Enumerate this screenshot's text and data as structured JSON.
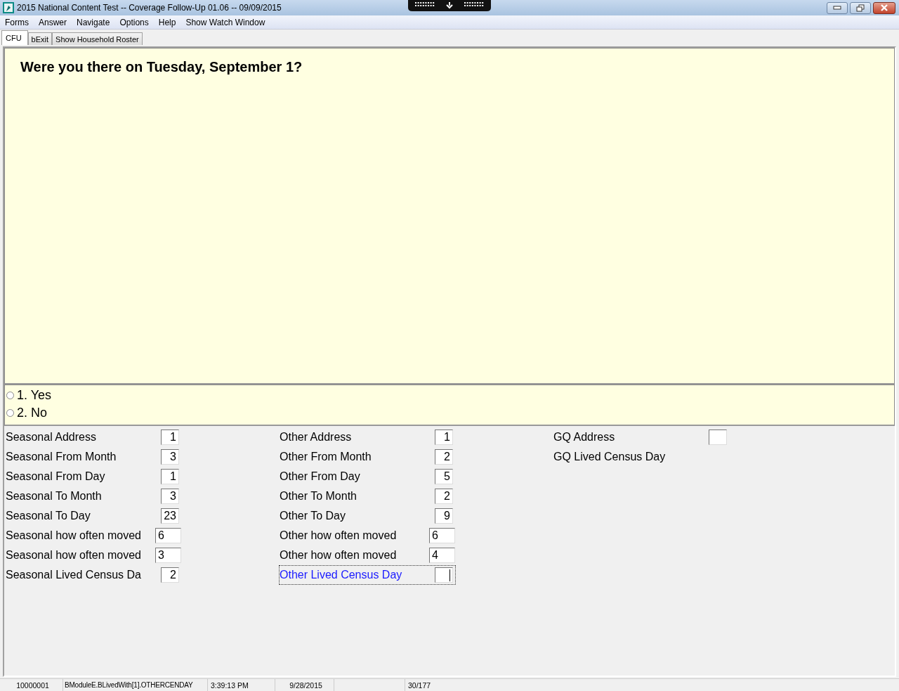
{
  "window": {
    "title": "2015 National Content Test -- Coverage Follow-Up 01.06 -- 09/09/2015"
  },
  "menu": [
    "Forms",
    "Answer",
    "Navigate",
    "Options",
    "Help",
    "Show Watch Window"
  ],
  "tabs": [
    {
      "label": "CFU",
      "selected": true
    },
    {
      "label": "bExit",
      "selected": false
    },
    {
      "label": "Show Household Roster",
      "selected": false
    }
  ],
  "question": "Were you there on Tuesday, September 1?",
  "answers": [
    {
      "label": "1. Yes",
      "selected": false
    },
    {
      "label": "2. No",
      "selected": false
    }
  ],
  "field_columns": [
    [
      {
        "label": "Seasonal Address",
        "value": "1",
        "kind": "narrow",
        "focused": false
      },
      {
        "label": "Seasonal From Month",
        "value": "3",
        "kind": "narrow",
        "focused": false
      },
      {
        "label": "Seasonal From Day",
        "value": "1",
        "kind": "narrow",
        "focused": false
      },
      {
        "label": "Seasonal To Month",
        "value": "3",
        "kind": "narrow",
        "focused": false
      },
      {
        "label": "Seasonal To Day",
        "value": "23",
        "kind": "narrow",
        "focused": false
      },
      {
        "label": "Seasonal how often moved",
        "value": "6",
        "kind": "wide",
        "focused": false
      },
      {
        "label": "Seasonal how often moved",
        "value": "3",
        "kind": "wide",
        "focused": false
      },
      {
        "label": "Seasonal Lived Census Da",
        "value": "2",
        "kind": "narrow",
        "focused": false
      }
    ],
    [
      {
        "label": "Other Address",
        "value": "1",
        "kind": "narrow",
        "focused": false
      },
      {
        "label": "Other From Month",
        "value": "2",
        "kind": "narrow",
        "focused": false
      },
      {
        "label": "Other From Day",
        "value": "5",
        "kind": "narrow",
        "focused": false
      },
      {
        "label": "Other To Month",
        "value": "2",
        "kind": "narrow",
        "focused": false
      },
      {
        "label": "Other To Day",
        "value": "9",
        "kind": "narrow",
        "focused": false
      },
      {
        "label": "Other how often moved",
        "value": "6",
        "kind": "wide",
        "focused": false
      },
      {
        "label": "Other how often moved",
        "value": "4",
        "kind": "wide",
        "focused": false
      },
      {
        "label": "Other Lived Census Day",
        "kind": "narrow",
        "focused": true
      }
    ],
    [
      {
        "label": "GQ Address",
        "kind": "narrow",
        "focused": false
      },
      {
        "label": "GQ Lived Census Day",
        "kind": "none",
        "focused": false
      }
    ]
  ],
  "status_bar": [
    "10000001",
    "BModuleE.BLivedWith[1].OTHERCENDAY",
    "3:39:13 PM",
    "9/28/2015",
    "30/177"
  ]
}
